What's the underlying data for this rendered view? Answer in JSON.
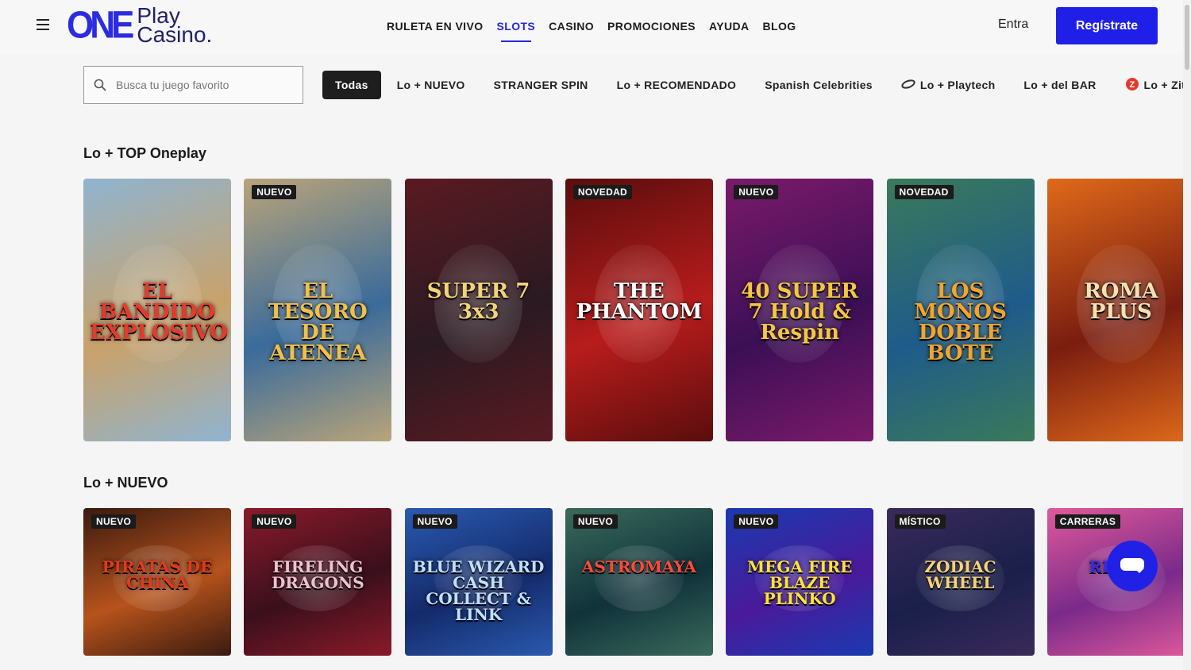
{
  "header": {
    "logo": {
      "mark": "ONE",
      "line1": "Play",
      "line2": "Casino."
    },
    "nav": [
      {
        "label": "RULETA EN VIVO",
        "active": false
      },
      {
        "label": "SLOTS",
        "active": true
      },
      {
        "label": "CASINO",
        "active": false
      },
      {
        "label": "PROMOCIONES",
        "active": false
      },
      {
        "label": "AYUDA",
        "active": false
      },
      {
        "label": "BLOG",
        "active": false
      }
    ],
    "login_label": "Entra",
    "register_label": "Regístrate"
  },
  "search": {
    "placeholder": "Busca tu juego favorito"
  },
  "categories": [
    {
      "label": "Todas",
      "active": true,
      "icon": null
    },
    {
      "label": "Lo + NUEVO",
      "active": false,
      "icon": null
    },
    {
      "label": "STRANGER SPIN",
      "active": false,
      "icon": null
    },
    {
      "label": "Lo + RECOMENDADO",
      "active": false,
      "icon": null
    },
    {
      "label": "Spanish Celebrities",
      "active": false,
      "icon": null
    },
    {
      "label": "Lo + Playtech",
      "active": false,
      "icon": "playtech-icon"
    },
    {
      "label": "Lo + del BAR",
      "active": false,
      "icon": null
    },
    {
      "label": "Lo + Zitro",
      "active": false,
      "icon": "zitro-icon"
    }
  ],
  "sections": [
    {
      "title": "Lo + TOP Oneplay",
      "games": [
        {
          "badge": "",
          "title": "EL BANDIDO EXPLOSIVO",
          "bg": "#c9a26a",
          "bg2": "#8fb4d0",
          "fg": "#e8392a"
        },
        {
          "badge": "NUEVO",
          "title": "EL TESORO DE ATENEA",
          "bg": "#3a6b9a",
          "bg2": "#b9a47a",
          "fg": "#f1c04b"
        },
        {
          "badge": "",
          "title": "SUPER 7 3x3",
          "bg": "#2a1a22",
          "bg2": "#5a1a22",
          "fg": "#f3d27a"
        },
        {
          "badge": "NOVEDAD",
          "title": "THE PHANTOM",
          "bg": "#b81c1c",
          "bg2": "#5a0d0d",
          "fg": "#ffffff"
        },
        {
          "badge": "NUEVO",
          "title": "40 SUPER 7 Hold & Respin",
          "bg": "#3b0f55",
          "bg2": "#7a1a6a",
          "fg": "#f5c542"
        },
        {
          "badge": "NOVEDAD",
          "title": "LOS MONOS DOBLE BOTE",
          "bg": "#1f5b8a",
          "bg2": "#3a7a5a",
          "fg": "#f3a52b"
        },
        {
          "badge": "",
          "title": "ROMA PLUS",
          "bg": "#7a1d10",
          "bg2": "#e06a1a",
          "fg": "#f3e2b0"
        }
      ]
    },
    {
      "title": "Lo + NUEVO",
      "games": [
        {
          "badge": "NUEVO",
          "title": "PIRATAS DE CHINA",
          "bg": "#b6531c",
          "bg2": "#3a1a0f",
          "fg": "#e33a1c"
        },
        {
          "badge": "NUEVO",
          "title": "FIRELING DRAGONS",
          "bg": "#3a0f1c",
          "bg2": "#8a1a2a",
          "fg": "#f0c0d0"
        },
        {
          "badge": "NUEVO",
          "title": "BLUE WIZARD CASH COLLECT & LINK",
          "bg": "#142a6a",
          "bg2": "#2a5ab0",
          "fg": "#bfe0ff"
        },
        {
          "badge": "NUEVO",
          "title": "ASTROMAYA",
          "bg": "#10323a",
          "bg2": "#3a6a5a",
          "fg": "#ff4a3a"
        },
        {
          "badge": "NUEVO",
          "title": "MEGA FIRE BLAZE PLINKO",
          "bg": "#4a1a9a",
          "bg2": "#1a3ab0",
          "fg": "#ffe23a"
        },
        {
          "badge": "MÍSTICO",
          "title": "ZODIAC WHEEL",
          "bg": "#1a1f4a",
          "bg2": "#3a2a5a",
          "fg": "#f3d27a"
        },
        {
          "badge": "CARRERAS",
          "title": "RIDE X",
          "bg": "#7a2a8a",
          "bg2": "#e05a9a",
          "fg": "#3a2ae6"
        }
      ]
    }
  ],
  "colors": {
    "brand": "#1f1fe8",
    "chip_active": "#1e1e1e"
  }
}
